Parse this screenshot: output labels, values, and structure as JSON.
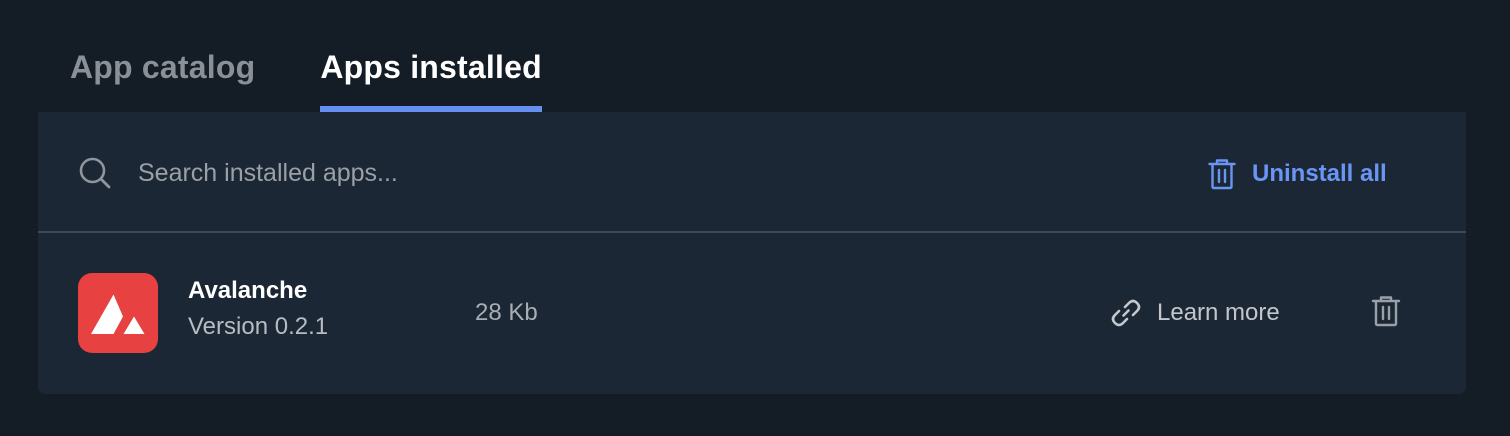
{
  "tabs": {
    "catalog": "App catalog",
    "installed": "Apps installed",
    "active": "installed"
  },
  "search": {
    "placeholder": "Search installed apps...",
    "value": "",
    "icon": "search-icon"
  },
  "toolbar": {
    "uninstall_all_label": "Uninstall all",
    "uninstall_all_icon": "trash-icon"
  },
  "apps": [
    {
      "name": "Avalanche",
      "version": "Version 0.2.1",
      "size": "28 Kb",
      "learn_more_label": "Learn more",
      "logo": "avalanche-logo",
      "link_icon": "link-icon",
      "delete_icon": "trash-icon"
    }
  ],
  "colors": {
    "background": "#141c26",
    "panel": "#1b2735",
    "accent": "#6490f1",
    "brand_avalanche": "#e84142"
  }
}
